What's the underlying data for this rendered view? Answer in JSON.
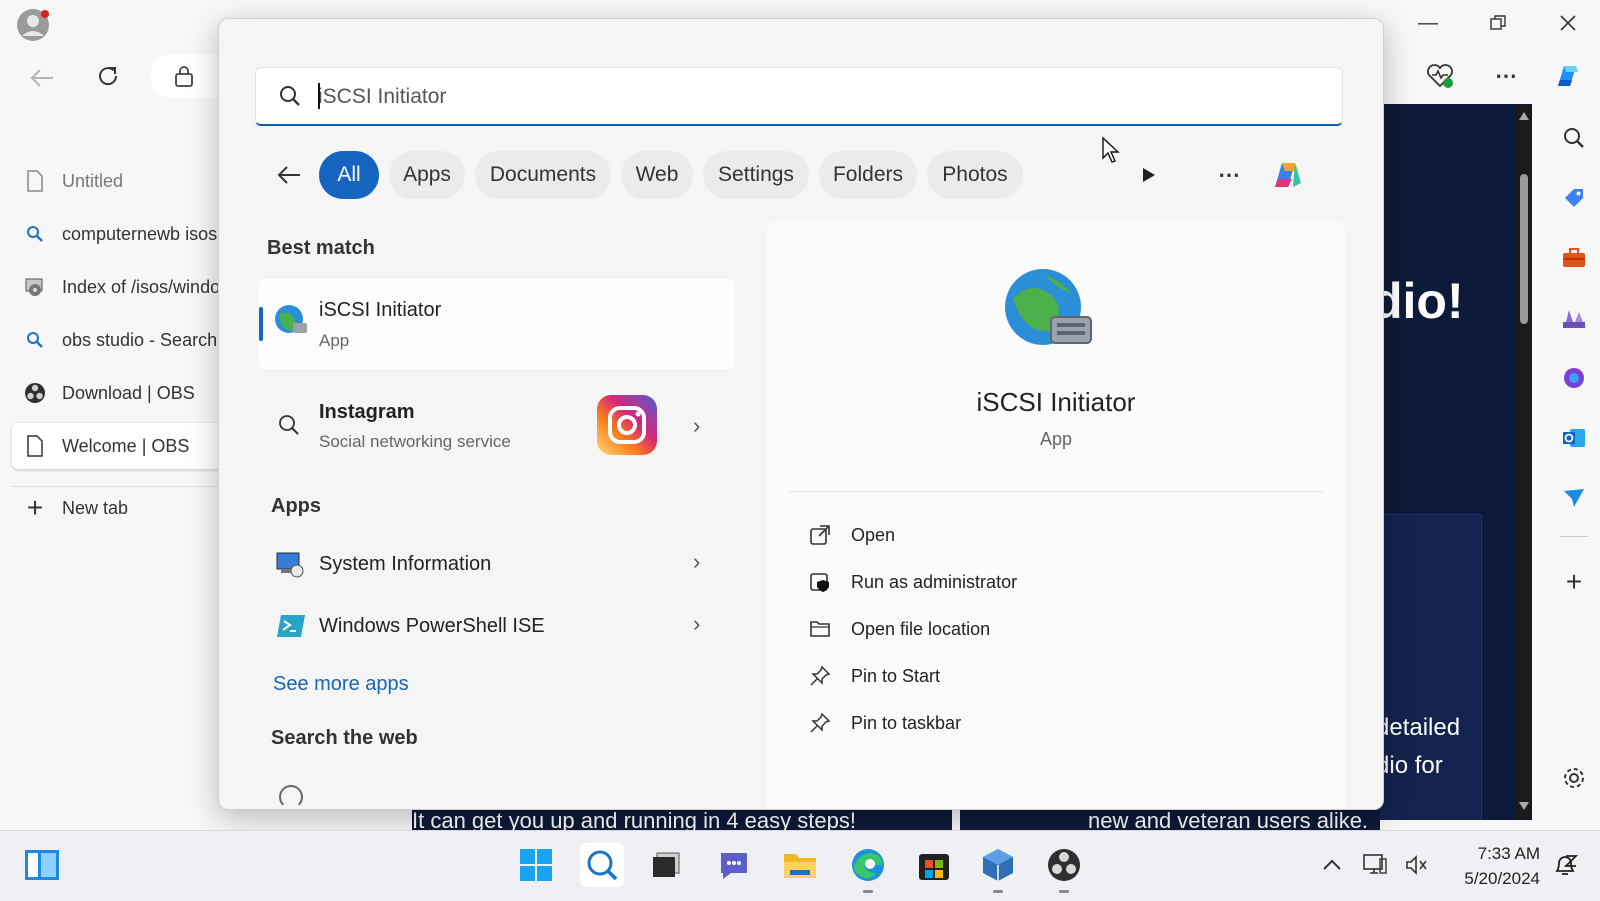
{
  "browser": {
    "window_title": "Welcome | OBS",
    "tabs": [
      {
        "label": "Untitled"
      },
      {
        "label": "computernewb isos"
      },
      {
        "label": "Index of /isos/windows"
      },
      {
        "label": "obs studio - Search"
      },
      {
        "label": "Download | OBS"
      },
      {
        "label": "Welcome | OBS"
      }
    ],
    "new_tab_label": "New tab",
    "page_text": {
      "heading_fragment": "dio!",
      "line1": "e detailed",
      "line2": "tudio for",
      "bottom_left": "It can get you up and running in 4 easy steps!",
      "bottom_right": "new and veteran users alike."
    }
  },
  "search": {
    "query": "iSCSI Initiator",
    "filters": [
      "All",
      "Apps",
      "Documents",
      "Web",
      "Settings",
      "Folders",
      "Photos"
    ],
    "active_filter": "All",
    "best_match_heading": "Best match",
    "best_match": {
      "title": "iSCSI Initiator",
      "subtitle": "App"
    },
    "suggestion": {
      "title": "Instagram",
      "subtitle": "Social networking service"
    },
    "apps_heading": "Apps",
    "apps": [
      {
        "label": "System Information"
      },
      {
        "label": "Windows PowerShell ISE"
      }
    ],
    "see_more_label": "See more apps",
    "web_heading": "Search the web",
    "detail": {
      "title": "iSCSI Initiator",
      "subtitle": "App",
      "actions": [
        "Open",
        "Run as administrator",
        "Open file location",
        "Pin to Start",
        "Pin to taskbar"
      ]
    }
  },
  "taskbar": {
    "time": "7:33 AM",
    "date": "5/20/2024"
  },
  "colors": {
    "accent": "#1565c0",
    "page_bg": "#0e1a3a"
  }
}
